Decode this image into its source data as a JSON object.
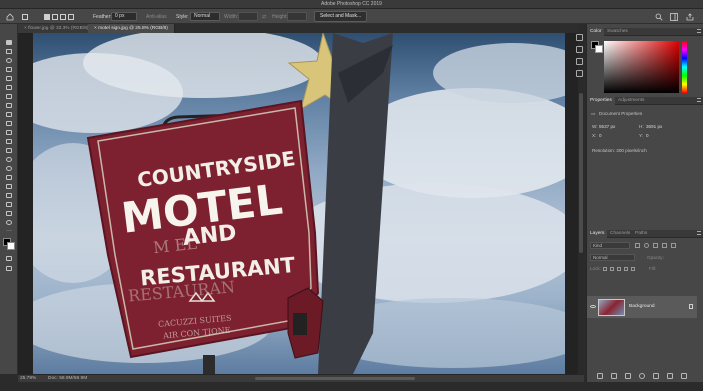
{
  "app": {
    "title": "Adobe Photoshop CC 2019"
  },
  "options_bar": {
    "feather_label": "Feather:",
    "feather_value": "0 px",
    "antialias_label": "Anti-alias",
    "style_label": "Style:",
    "style_value": "Normal",
    "width_label": "Width:",
    "height_label": "Height:",
    "select_mask_label": "Select and Mask..."
  },
  "tabs": [
    {
      "label": "flower.jpg @ 33.3% (RGB/8)",
      "active": false
    },
    {
      "label": "motel sign.jpg @ 25.8% (RGB/8)",
      "active": true
    }
  ],
  "sign": {
    "line1": "COUNTRYSIDE",
    "line2": "MOTEL",
    "line3": "AND",
    "line4": "RESTAURANT",
    "faded1": "M  EL",
    "faded2": "RESTAURAN",
    "faded3": "CACUZZI SUITES",
    "faded4": "AIR CON TIONE"
  },
  "status": {
    "zoom": "25.79%",
    "doc": "Doc: 58.9M/58.9M"
  },
  "color_panel": {
    "tabs": [
      "Color",
      "Swatches"
    ],
    "accent": "#e00000"
  },
  "properties_panel": {
    "tabs": [
      "Properties",
      "Adjustments"
    ],
    "section": "Document Properties",
    "w_label": "W:",
    "w_value": "5537 px",
    "h_label": "H:",
    "h_value": "3691 px",
    "x_label": "X:",
    "x_value": "0",
    "y_label": "Y:",
    "y_value": "0",
    "resolution": "Resolution: 300 pixels/inch"
  },
  "layers_panel": {
    "tabs": [
      "Layers",
      "Channels",
      "Paths"
    ],
    "kind_label": "Kind",
    "blend_mode": "Normal",
    "opacity_label": "Opacity:",
    "lock_label": "Lock:",
    "fill_label": "Fill:",
    "layers": [
      {
        "name": "Background",
        "visible": true,
        "locked": true
      }
    ]
  }
}
